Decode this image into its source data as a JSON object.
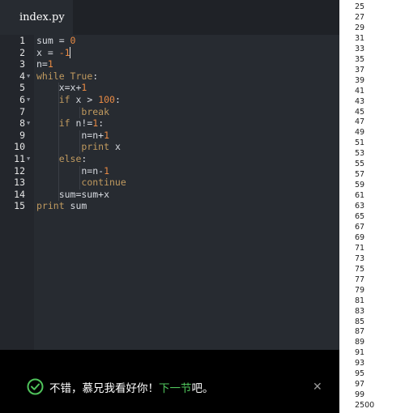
{
  "editor": {
    "tab_label": "index.py",
    "lines": [
      {
        "n": "1",
        "fold": false,
        "tokens": [
          {
            "t": "sum = ",
            "c": "id"
          },
          {
            "t": "0",
            "c": "num"
          }
        ]
      },
      {
        "n": "2",
        "fold": false,
        "tokens": [
          {
            "t": "x = ",
            "c": "id"
          },
          {
            "t": "-1",
            "c": "num"
          }
        ]
      },
      {
        "n": "3",
        "fold": false,
        "tokens": [
          {
            "t": "n=",
            "c": "id"
          },
          {
            "t": "1",
            "c": "num"
          }
        ]
      },
      {
        "n": "4",
        "fold": true,
        "tokens": [
          {
            "t": "while ",
            "c": "kw"
          },
          {
            "t": "True",
            "c": "kw"
          },
          {
            "t": ":",
            "c": "id"
          }
        ]
      },
      {
        "n": "5",
        "fold": false,
        "tokens": [
          {
            "t": "    x=x+",
            "c": "id"
          },
          {
            "t": "1",
            "c": "num"
          }
        ]
      },
      {
        "n": "6",
        "fold": true,
        "tokens": [
          {
            "t": "    ",
            "c": "id"
          },
          {
            "t": "if",
            "c": "kw"
          },
          {
            "t": " x > ",
            "c": "id"
          },
          {
            "t": "100",
            "c": "num"
          },
          {
            "t": ":",
            "c": "id"
          }
        ]
      },
      {
        "n": "7",
        "fold": false,
        "tokens": [
          {
            "t": "        ",
            "c": "id"
          },
          {
            "t": "break",
            "c": "kw"
          }
        ]
      },
      {
        "n": "8",
        "fold": true,
        "tokens": [
          {
            "t": "    ",
            "c": "id"
          },
          {
            "t": "if",
            "c": "kw"
          },
          {
            "t": " n!=",
            "c": "id"
          },
          {
            "t": "1",
            "c": "num"
          },
          {
            "t": ":",
            "c": "id"
          }
        ]
      },
      {
        "n": "9",
        "fold": false,
        "tokens": [
          {
            "t": "        n=n+",
            "c": "id"
          },
          {
            "t": "1",
            "c": "num"
          }
        ]
      },
      {
        "n": "10",
        "fold": false,
        "tokens": [
          {
            "t": "        ",
            "c": "id"
          },
          {
            "t": "print",
            "c": "kw"
          },
          {
            "t": " x",
            "c": "id"
          }
        ]
      },
      {
        "n": "11",
        "fold": true,
        "tokens": [
          {
            "t": "    ",
            "c": "id"
          },
          {
            "t": "else",
            "c": "kw"
          },
          {
            "t": ":",
            "c": "id"
          }
        ]
      },
      {
        "n": "12",
        "fold": false,
        "tokens": [
          {
            "t": "        n=n-",
            "c": "id"
          },
          {
            "t": "1",
            "c": "num"
          }
        ]
      },
      {
        "n": "13",
        "fold": false,
        "tokens": [
          {
            "t": "        ",
            "c": "id"
          },
          {
            "t": "continue",
            "c": "kw"
          }
        ]
      },
      {
        "n": "14",
        "fold": false,
        "tokens": [
          {
            "t": "    sum=sum+x",
            "c": "id"
          }
        ]
      },
      {
        "n": "15",
        "fold": false,
        "tokens": [
          {
            "t": "print",
            "c": "kw"
          },
          {
            "t": " sum",
            "c": "id"
          }
        ]
      }
    ]
  },
  "banner": {
    "message_before": "不错，慕兄我看好你！",
    "message_link": "下一节",
    "message_after": "吧。",
    "icons": {
      "check": "check-circle-icon",
      "close": "close-icon"
    }
  },
  "output": {
    "values": [
      "25",
      "27",
      "29",
      "31",
      "33",
      "35",
      "37",
      "39",
      "41",
      "43",
      "45",
      "47",
      "49",
      "51",
      "53",
      "55",
      "57",
      "59",
      "61",
      "63",
      "65",
      "67",
      "69",
      "71",
      "73",
      "75",
      "77",
      "79",
      "81",
      "83",
      "85",
      "87",
      "89",
      "91",
      "93",
      "95",
      "97",
      "99",
      "2500"
    ]
  },
  "colors": {
    "editor_bg": "#272b31",
    "keyword": "#c09a5f",
    "number": "#e88a44",
    "identifier": "#d7dae0",
    "link_green": "#4fc35b"
  }
}
